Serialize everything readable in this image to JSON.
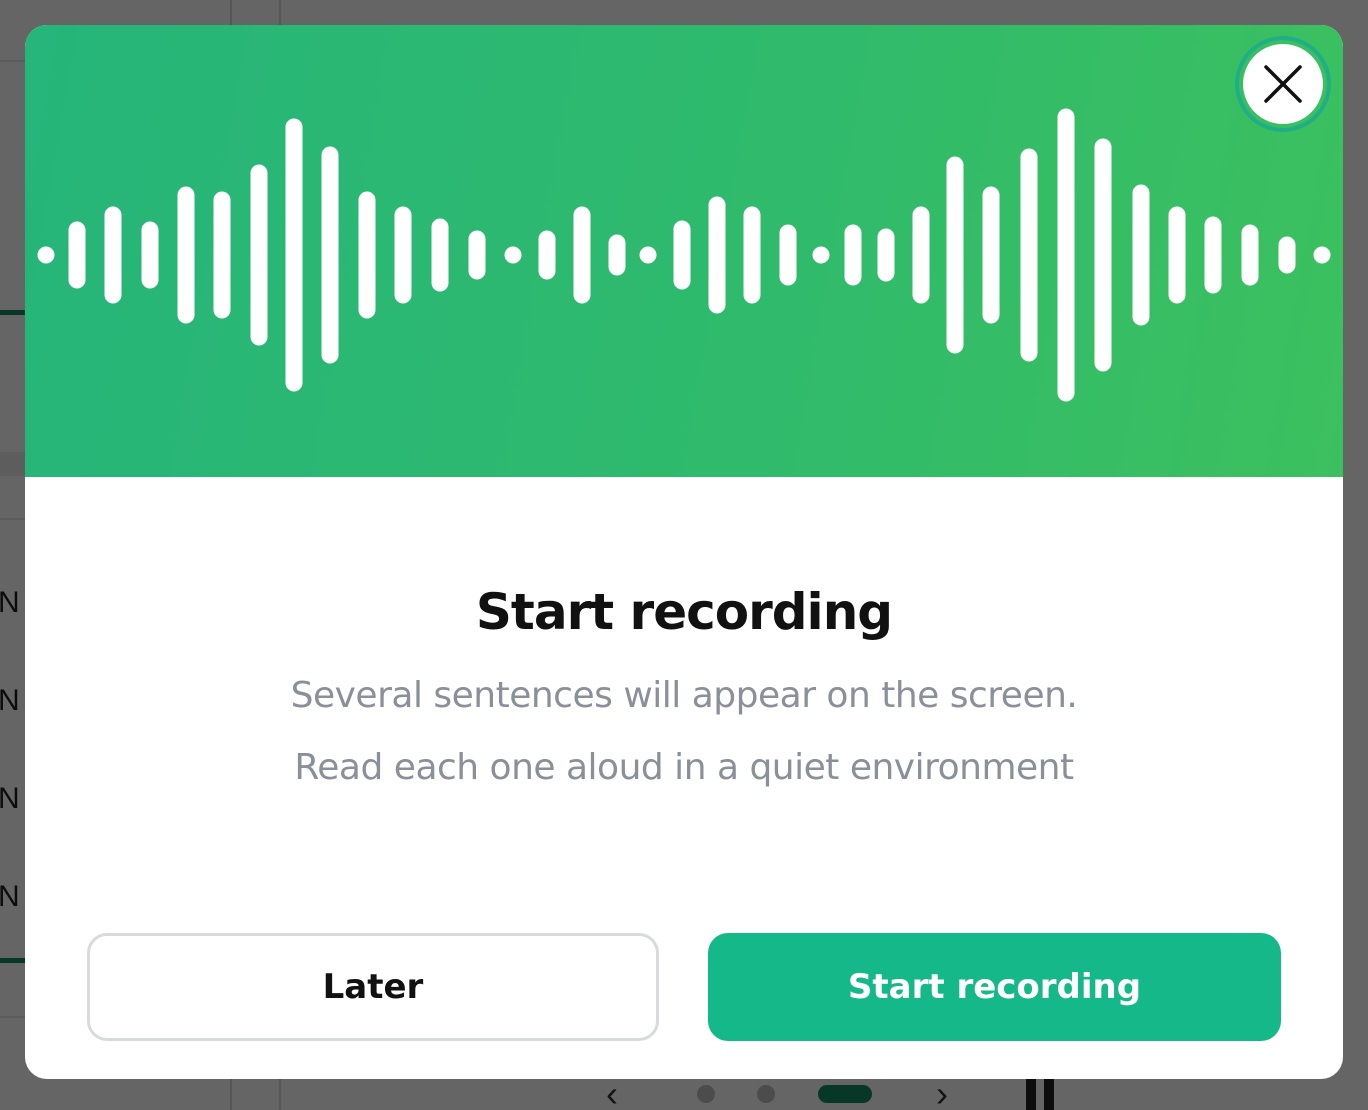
{
  "modal": {
    "title": "Start recording",
    "description_line1": "Several sentences will appear on the screen.",
    "description_line2": "Read each one aloud in a quiet environment",
    "later_label": "Later",
    "start_label": "Start recording",
    "close_icon": "close-icon",
    "hero_icon": "sound-wave-icon",
    "colors": {
      "hero_gradient_start": "#26b57a",
      "hero_gradient_end": "#3cc05f",
      "primary_button": "#14b889",
      "title_text": "#111111",
      "description_text": "#8a9099"
    }
  },
  "background": {
    "row_letters": [
      "N",
      "N",
      "N",
      "N"
    ]
  }
}
